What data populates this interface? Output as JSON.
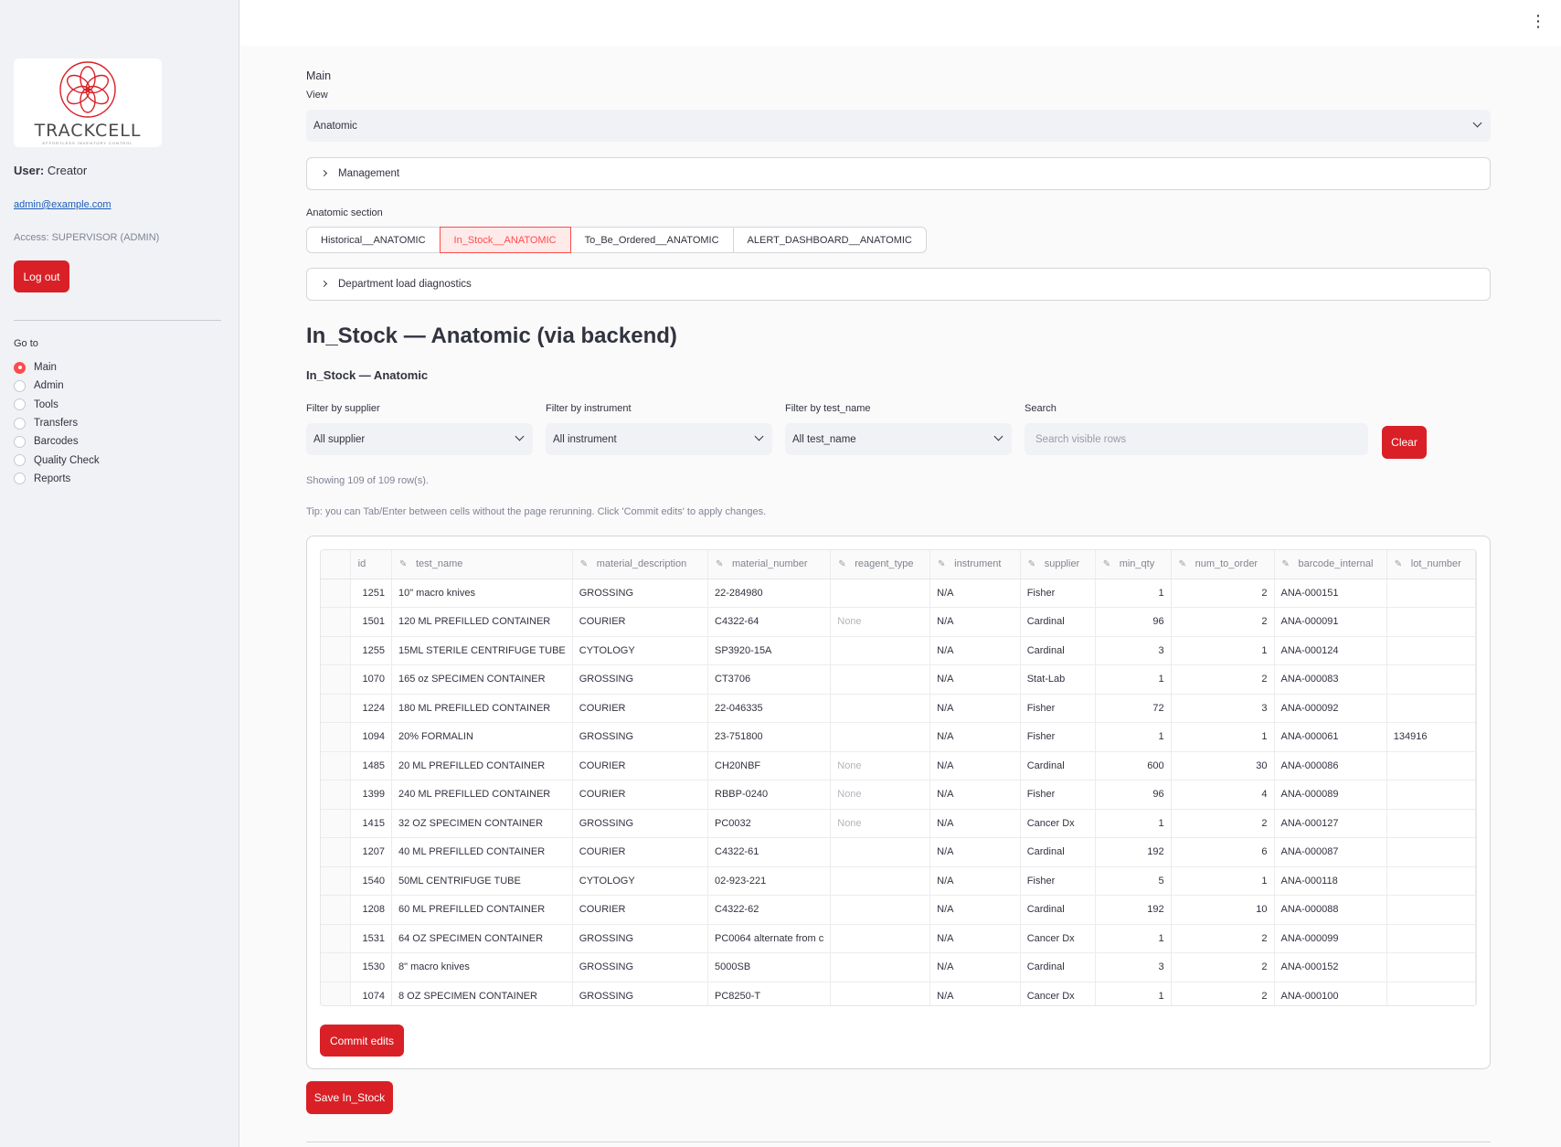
{
  "sidebar": {
    "logo_text": "TRACKCELL",
    "logo_tagline": "EFFORTLESS INVENTORY CONTROL",
    "user_label": "User:",
    "user_name": "Creator",
    "email": "admin@example.com",
    "access": "Access: SUPERVISOR (ADMIN)",
    "logout_label": "Log out",
    "goto_label": "Go to",
    "nav": [
      {
        "label": "Main",
        "selected": true
      },
      {
        "label": "Admin",
        "selected": false
      },
      {
        "label": "Tools",
        "selected": false
      },
      {
        "label": "Transfers",
        "selected": false
      },
      {
        "label": "Barcodes",
        "selected": false
      },
      {
        "label": "Quality Check",
        "selected": false
      },
      {
        "label": "Reports",
        "selected": false
      }
    ]
  },
  "main": {
    "main_label": "Main",
    "view_label": "View",
    "view_value": "Anatomic",
    "management_label": "Management",
    "section_label": "Anatomic section",
    "tabs": [
      {
        "label": "Historical__ANATOMIC",
        "active": false
      },
      {
        "label": "In_Stock__ANATOMIC",
        "active": true
      },
      {
        "label": "To_Be_Ordered__ANATOMIC",
        "active": false
      },
      {
        "label": "ALERT_DASHBOARD__ANATOMIC",
        "active": false
      }
    ],
    "diagnostics_label": "Department load diagnostics",
    "title": "In_Stock — Anatomic (via backend)",
    "subtitle": "In_Stock — Anatomic",
    "filters": {
      "supplier_label": "Filter by supplier",
      "supplier_value": "All supplier",
      "instrument_label": "Filter by instrument",
      "instrument_value": "All instrument",
      "test_name_label": "Filter by test_name",
      "test_name_value": "All test_name",
      "search_label": "Search",
      "search_placeholder": "Search visible rows",
      "clear_label": "Clear"
    },
    "showing": "Showing 109 of 109 row(s).",
    "tip": "Tip: you can Tab/Enter between cells without the page rerunning. Click 'Commit edits' to apply changes.",
    "commit_label": "Commit edits",
    "save_label": "Save In_Stock"
  },
  "table": {
    "columns": [
      "id",
      "test_name",
      "material_description",
      "material_number",
      "reagent_type",
      "instrument",
      "supplier",
      "min_qty",
      "num_to_order",
      "barcode_internal",
      "lot_number"
    ],
    "rows": [
      [
        "1251",
        "10\" macro knives",
        "GROSSING",
        "22-284980",
        "",
        "N/A",
        "Fisher",
        "1",
        "2",
        "ANA-000151",
        ""
      ],
      [
        "1501",
        "120 ML PREFILLED CONTAINER",
        "COURIER",
        "C4322-64",
        "None",
        "N/A",
        "Cardinal",
        "96",
        "2",
        "ANA-000091",
        ""
      ],
      [
        "1255",
        "15ML STERILE CENTRIFUGE TUBE",
        "CYTOLOGY",
        "SP3920-15A",
        "",
        "N/A",
        "Cardinal",
        "3",
        "1",
        "ANA-000124",
        ""
      ],
      [
        "1070",
        "165 oz SPECIMEN CONTAINER",
        "GROSSING",
        "CT3706",
        "",
        "N/A",
        "Stat-Lab",
        "1",
        "2",
        "ANA-000083",
        ""
      ],
      [
        "1224",
        "180 ML PREFILLED CONTAINER",
        "COURIER",
        "22-046335",
        "",
        "N/A",
        "Fisher",
        "72",
        "3",
        "ANA-000092",
        ""
      ],
      [
        "1094",
        "20% FORMALIN",
        "GROSSING",
        "23-751800",
        "",
        "N/A",
        "Fisher",
        "1",
        "1",
        "ANA-000061",
        "134916"
      ],
      [
        "1485",
        "20 ML PREFILLED CONTAINER",
        "COURIER",
        " CH20NBF",
        "None",
        "N/A",
        "Cardinal",
        "600",
        "30",
        "ANA-000086",
        ""
      ],
      [
        "1399",
        "240 ML PREFILLED CONTAINER",
        "COURIER",
        "RBBP-0240",
        "None",
        "N/A",
        "Fisher",
        "96",
        "4",
        "ANA-000089",
        ""
      ],
      [
        "1415",
        "32 OZ SPECIMEN CONTAINER",
        "GROSSING",
        "PC0032",
        "None",
        "N/A",
        "Cancer Dx",
        "1",
        "2",
        "ANA-000127",
        ""
      ],
      [
        "1207",
        "40 ML PREFILLED CONTAINER",
        "COURIER",
        "C4322-61",
        "",
        "N/A",
        "Cardinal",
        "192",
        "6",
        "ANA-000087",
        ""
      ],
      [
        "1540",
        "50ML CENTRIFUGE TUBE",
        "CYTOLOGY",
        "02-923-221",
        "",
        "N/A",
        "Fisher",
        "5",
        "1",
        "ANA-000118",
        ""
      ],
      [
        "1208",
        "60 ML PREFILLED CONTAINER",
        "COURIER",
        "C4322-62",
        "",
        "N/A",
        "Cardinal",
        "192",
        "10",
        "ANA-000088",
        ""
      ],
      [
        "1531",
        "64 OZ SPECIMEN CONTAINER",
        "GROSSING",
        "PC0064  alternate from c",
        "",
        "N/A",
        "Cancer Dx",
        "1",
        "2",
        "ANA-000099",
        ""
      ],
      [
        "1530",
        "8\" macro knives",
        "GROSSING",
        "5000SB",
        "",
        "N/A",
        "Cardinal",
        "3",
        "2",
        "ANA-000152",
        ""
      ],
      [
        "1074",
        "8 OZ SPECIMEN CONTAINER",
        "GROSSING",
        "PC8250-T",
        "",
        "N/A",
        "Cancer Dx",
        "1",
        "2",
        "ANA-000100",
        ""
      ]
    ]
  },
  "colors": {
    "accent": "#d92027",
    "active_tab": "#ff4b4b",
    "sidebar_bg": "#f0f2f6"
  },
  "icons": {
    "logo": "trackcell-logo-icon",
    "menu": "kebab-menu-icon",
    "dropdown": "chevron-down-icon",
    "expander": "chevron-right-icon",
    "editable_column": "edit-pencil-icon"
  }
}
